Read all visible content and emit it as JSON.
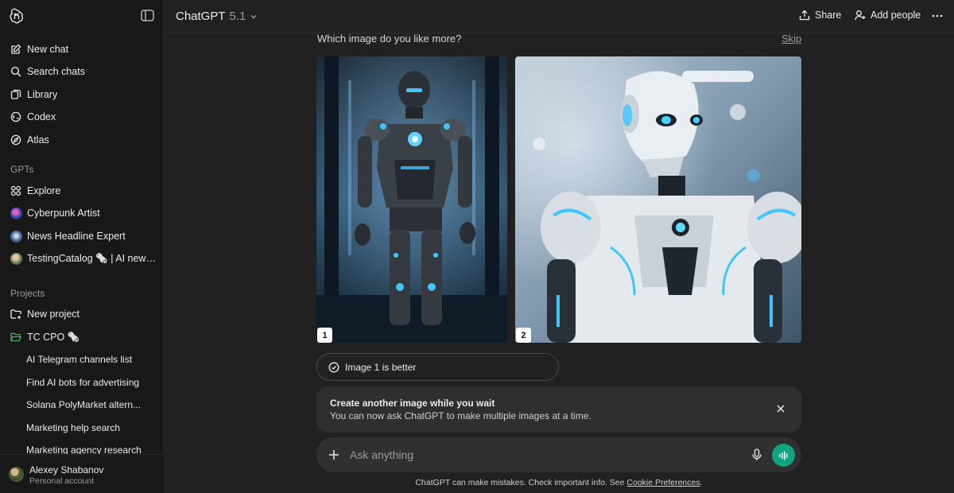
{
  "sidebar": {
    "top_items": [
      {
        "label": "New chat",
        "icon": "new-chat-icon"
      },
      {
        "label": "Search chats",
        "icon": "search-icon"
      },
      {
        "label": "Library",
        "icon": "library-icon"
      },
      {
        "label": "Codex",
        "icon": "codex-icon"
      },
      {
        "label": "Atlas",
        "icon": "atlas-icon"
      }
    ],
    "gpts_heading": "GPTs",
    "gpts": [
      {
        "label": "Explore",
        "icon": "explore-icon"
      },
      {
        "label": "Cyberpunk Artist",
        "icon": "gpt-avatar"
      },
      {
        "label": "News Headline Expert",
        "icon": "gpt-avatar"
      },
      {
        "label": "TestingCatalog 🗞️ | AI news &...",
        "icon": "gpt-avatar"
      }
    ],
    "projects_heading": "Projects",
    "projects": [
      {
        "label": "New project",
        "icon": "new-project-icon"
      },
      {
        "label": "TC CPO 🗞️",
        "icon": "folder-icon"
      }
    ],
    "project_chats": [
      "AI Telegram channels list",
      "Find AI bots for advertising",
      "Solana PolyMarket altern...",
      "Marketing help search",
      "Marketing agency research"
    ],
    "user": {
      "name": "Alexey Shabanov",
      "plan": "Personal account"
    }
  },
  "header": {
    "model_name": "ChatGPT",
    "model_version": "5.1",
    "share_label": "Share",
    "add_people_label": "Add people"
  },
  "comparison": {
    "question": "Which image do you like more?",
    "skip_label": "Skip",
    "image1_number": "1",
    "image2_number": "2",
    "preference_label": "Image 1 is better"
  },
  "notice": {
    "title": "Create another image while you wait",
    "text": "You can now ask ChatGPT to make multiple images at a time."
  },
  "composer": {
    "placeholder": "Ask anything"
  },
  "footer": {
    "disclaimer": "ChatGPT can make mistakes. Check important info. See ",
    "link": "Cookie Preferences",
    "end": "."
  },
  "colors": {
    "background": "#212121",
    "sidebar": "#181818",
    "accent_green": "#10a37f",
    "glow_blue": "#2ec5ff"
  }
}
